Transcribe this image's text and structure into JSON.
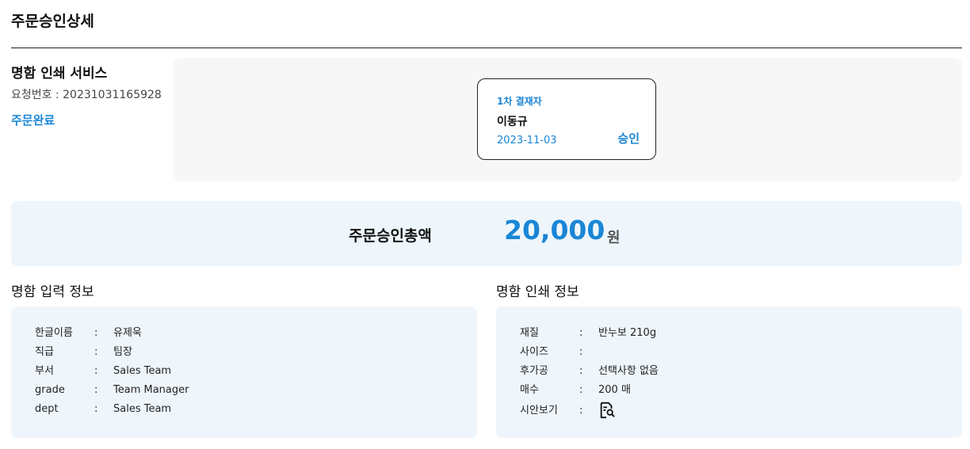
{
  "page": {
    "title": "주문승인상세"
  },
  "order": {
    "service_name": "명함 인쇄 서비스",
    "request_no": "요청번호 : 20231031165928",
    "status": "주문완료"
  },
  "approver": {
    "step": "1차 결재자",
    "name": "이동규",
    "date": "2023-11-03",
    "status": "승인"
  },
  "total": {
    "label": "주문승인총액",
    "amount": "20,000",
    "unit": "원"
  },
  "input_info": {
    "title": "명함 입력 정보",
    "rows": [
      {
        "label": "한글이름",
        "sep": ":",
        "value": "유제욱"
      },
      {
        "label": "직급",
        "sep": ":",
        "value": "팀장"
      },
      {
        "label": "부서",
        "sep": ":",
        "value": "Sales Team"
      },
      {
        "label": "grade",
        "sep": ":",
        "value": "Team Manager"
      },
      {
        "label": "dept",
        "sep": ":",
        "value": "Sales Team"
      }
    ]
  },
  "print_info": {
    "title": "명함 인쇄 정보",
    "rows": [
      {
        "label": "재질",
        "sep": ":",
        "value": "반누보 210g"
      },
      {
        "label": "사이즈",
        "sep": ":",
        "value": ""
      },
      {
        "label": "후가공",
        "sep": ":",
        "value": "선택사항 없음"
      },
      {
        "label": "매수",
        "sep": ":",
        "value": "200 매"
      },
      {
        "label": "시안보기",
        "sep": ":",
        "icon": "document-preview-icon"
      }
    ]
  },
  "colors": {
    "accent": "#1a86d6",
    "panel_gray": "#f7f7f7",
    "panel_blue": "#eef5fb"
  }
}
